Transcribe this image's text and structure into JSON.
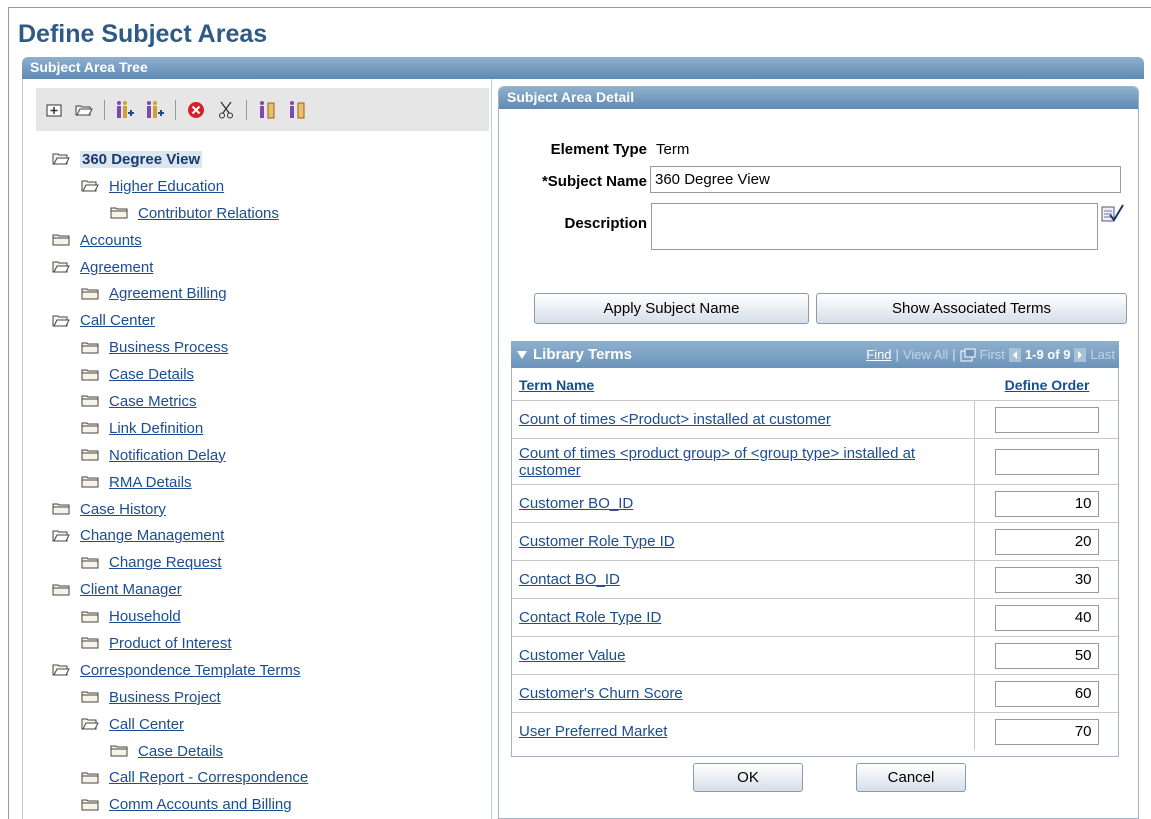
{
  "page": {
    "title": "Define Subject Areas"
  },
  "tree_section": {
    "title": "Subject Area Tree",
    "toolbar": [
      "add-sibling-folder-icon",
      "open-folder-icon",
      "insert-child-icon",
      "insert-sibling-icon",
      "delete-icon",
      "cut-icon",
      "paste-child-icon",
      "paste-sibling-icon"
    ],
    "nodes": [
      {
        "label": "360 Degree View",
        "level": 0,
        "open": true,
        "selected": true
      },
      {
        "label": "Higher Education",
        "level": 1,
        "open": true
      },
      {
        "label": "Contributor Relations",
        "level": 2,
        "open": false
      },
      {
        "label": "Accounts",
        "level": 0,
        "open": false
      },
      {
        "label": "Agreement",
        "level": 0,
        "open": true
      },
      {
        "label": "Agreement Billing",
        "level": 1,
        "open": false
      },
      {
        "label": "Call Center",
        "level": 0,
        "open": true
      },
      {
        "label": "Business Process",
        "level": 1,
        "open": false
      },
      {
        "label": "Case Details",
        "level": 1,
        "open": false
      },
      {
        "label": "Case Metrics",
        "level": 1,
        "open": false
      },
      {
        "label": "Link Definition",
        "level": 1,
        "open": false
      },
      {
        "label": "Notification Delay",
        "level": 1,
        "open": false
      },
      {
        "label": "RMA Details",
        "level": 1,
        "open": false
      },
      {
        "label": "Case History",
        "level": 0,
        "open": false
      },
      {
        "label": "Change Management",
        "level": 0,
        "open": true
      },
      {
        "label": "Change Request",
        "level": 1,
        "open": false
      },
      {
        "label": "Client Manager",
        "level": 0,
        "open": false
      },
      {
        "label": "Household",
        "level": 1,
        "open": false
      },
      {
        "label": "Product of Interest",
        "level": 1,
        "open": false
      },
      {
        "label": "Correspondence Template Terms",
        "level": 0,
        "open": true
      },
      {
        "label": "Business Project",
        "level": 1,
        "open": false
      },
      {
        "label": "Call Center",
        "level": 1,
        "open": true
      },
      {
        "label": "Case Details",
        "level": 2,
        "open": false
      },
      {
        "label": "Call Report - Correspondence",
        "level": 1,
        "open": false
      },
      {
        "label": "Comm Accounts and Billing",
        "level": 1,
        "open": false
      }
    ]
  },
  "detail": {
    "title": "Subject Area Detail",
    "element_type_label": "Element Type",
    "element_type_value": "Term",
    "subject_name_label": "*Subject Name",
    "subject_name_value": "360 Degree View",
    "description_label": "Description",
    "description_value": "",
    "apply_button": "Apply Subject Name",
    "show_terms_button": "Show Associated Terms",
    "ok_button": "OK",
    "cancel_button": "Cancel"
  },
  "library_terms": {
    "title": "Library Terms",
    "find": "Find",
    "sep1": "|",
    "view_all": "View All",
    "sep2": "|",
    "first": "First",
    "range": "1-9 of 9",
    "last": "Last",
    "col_term": "Term Name",
    "col_order": "Define Order",
    "rows": [
      {
        "name": "Count of times <Product> installed at customer",
        "order": ""
      },
      {
        "name": "Count of times <product group> of <group type> installed at customer",
        "order": ""
      },
      {
        "name": "Customer BO_ID",
        "order": "10"
      },
      {
        "name": "Customer Role Type ID",
        "order": "20"
      },
      {
        "name": "Contact BO_ID",
        "order": "30"
      },
      {
        "name": "Contact Role Type ID",
        "order": "40"
      },
      {
        "name": "Customer Value",
        "order": "50"
      },
      {
        "name": "Customer's Churn Score",
        "order": "60"
      },
      {
        "name": "User Preferred Market",
        "order": "70"
      }
    ]
  }
}
